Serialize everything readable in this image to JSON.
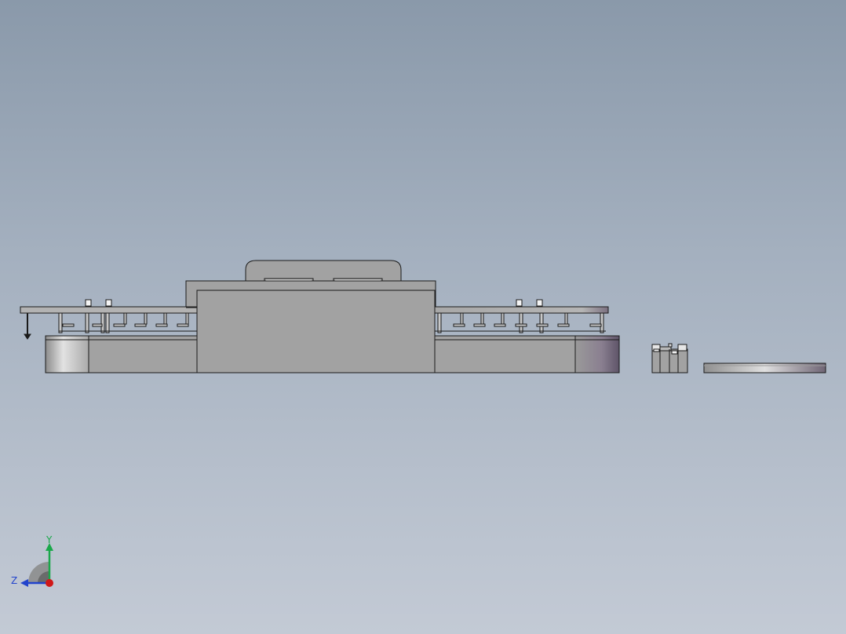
{
  "viewport": {
    "background_top": "#8a99aa",
    "background_bottom": "#c3cad5"
  },
  "model": {
    "edge_color": "#1a1a1a",
    "face_color": "#a2a2a2",
    "face_light": "#d4d4d4",
    "face_purple": "#7a6e80"
  },
  "triad": {
    "y_label": "Y",
    "z_label": "Z",
    "y_color": "#1aa84a",
    "z_color": "#2244cc",
    "origin_color": "#d01818"
  }
}
